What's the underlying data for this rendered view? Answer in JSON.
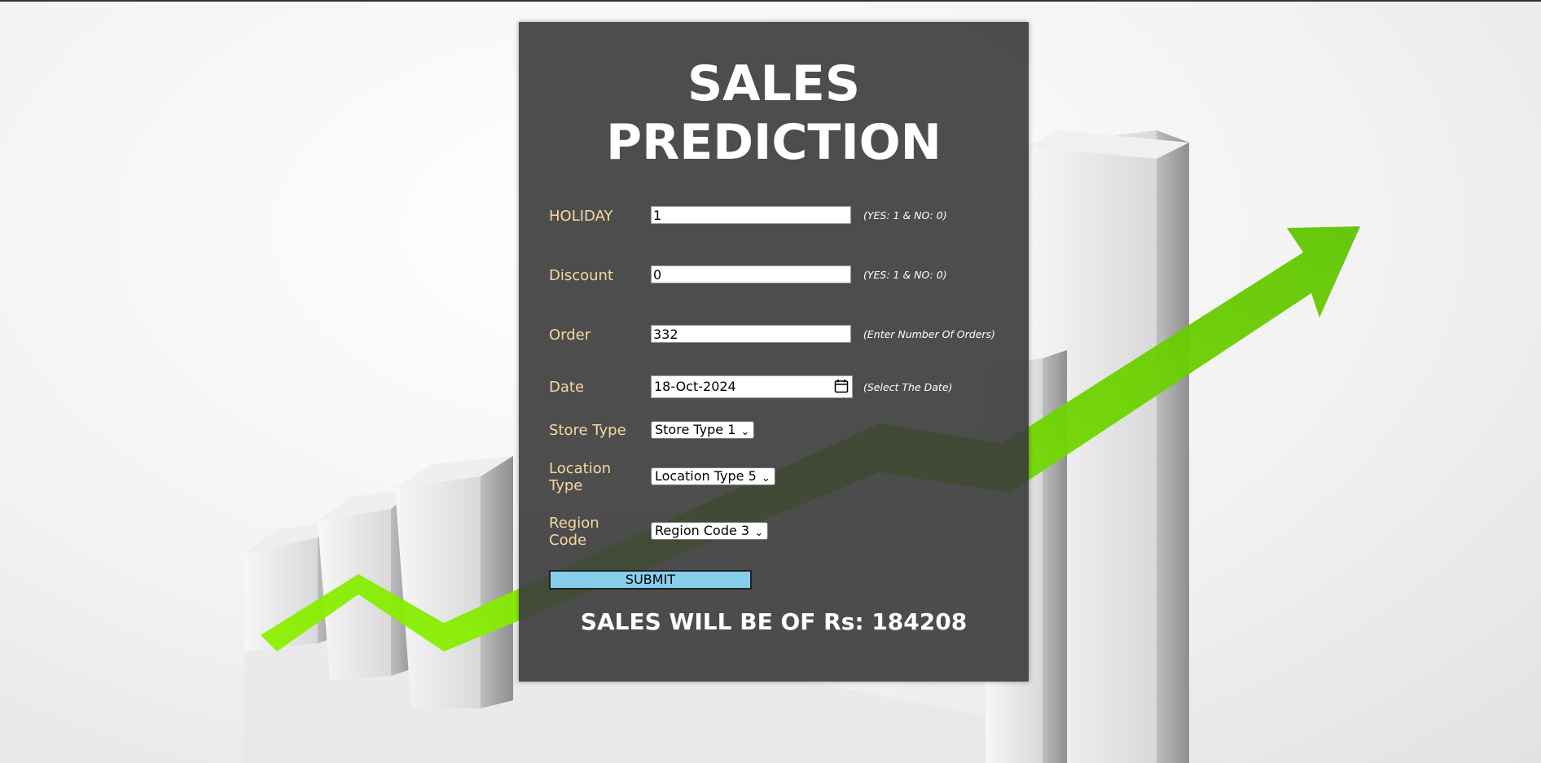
{
  "page": {
    "title_line1": "SALES",
    "title_line2": "PREDICTION"
  },
  "form": {
    "holiday": {
      "label": "HOLIDAY",
      "value": "1",
      "hint": "(YES: 1 & NO: 0)"
    },
    "discount": {
      "label": "Discount",
      "value": "0",
      "hint": "(YES: 1 & NO: 0)"
    },
    "order": {
      "label": "Order",
      "value": "332",
      "hint": "(Enter Number Of Orders)"
    },
    "date": {
      "label": "Date",
      "value": "18-Oct-2024",
      "hint": "(Select The Date)"
    },
    "store_type": {
      "label": "Store Type",
      "selected": "Store Type 1"
    },
    "location_type": {
      "label_line1": "Location",
      "label_line2": "Type",
      "selected": "Location Type 5"
    },
    "region_code": {
      "label_line1": "Region",
      "label_line2": "Code",
      "selected": "Region Code 3"
    },
    "submit_label": "SUBMIT"
  },
  "result": {
    "text": "SALES WILL BE OF Rs: 184208"
  },
  "colors": {
    "panel_bg": "#3a3a3a",
    "label": "#f5d9a0",
    "submit_bg": "#87ceeb",
    "arrow": "#7ed321"
  }
}
